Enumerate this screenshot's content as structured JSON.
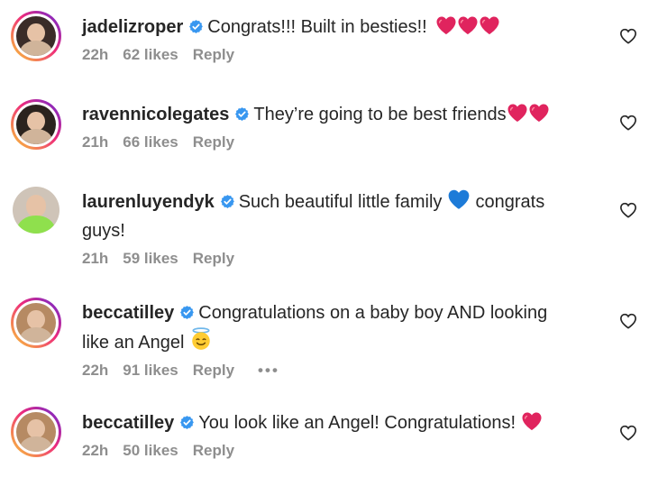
{
  "comments": [
    {
      "username": "jadelizroper",
      "text": "Congrats!!! Built in besties!!",
      "emoji_after": [
        "red-heart",
        "red-heart",
        "red-heart"
      ],
      "time": "22h",
      "likes": "62 likes",
      "reply": "Reply",
      "avatar_ring": "story"
    },
    {
      "username": "ravennicolegates",
      "text": "They’re going to be best friends",
      "emoji_after": [
        "red-heart",
        "red-heart"
      ],
      "time": "21h",
      "likes": "66 likes",
      "reply": "Reply",
      "avatar_ring": "story"
    },
    {
      "username": "laurenluyendyk",
      "text_line1_before": "Such beautiful little family",
      "text_line1_after": "congrats",
      "text_line2": "guys!",
      "inline_emoji": "blue-heart",
      "time": "21h",
      "likes": "59 likes",
      "reply": "Reply",
      "avatar_ring": "none"
    },
    {
      "username": "beccatilley",
      "text_line1": "Congratulations on a baby boy AND looking",
      "text_line2": "like an Angel",
      "emoji_after": [
        "smiling-face-with-halo"
      ],
      "time": "22h",
      "likes": "91 likes",
      "reply": "Reply",
      "more": "•••",
      "avatar_ring": "story"
    },
    {
      "username": "beccatilley",
      "text": "You look like an Angel! Congratulations!",
      "emoji_after": [
        "red-heart"
      ],
      "time": "22h",
      "likes": "50 likes",
      "reply": "Reply",
      "avatar_ring": "story"
    }
  ],
  "colors": {
    "text": "#262626",
    "meta": "#8e8e8e",
    "verified": "#3897f0",
    "heart_emoji": "#e0245e",
    "blue_heart": "#1d7bd8"
  },
  "icons": {
    "verified": "verified-badge-icon",
    "like": "heart-outline-icon"
  }
}
